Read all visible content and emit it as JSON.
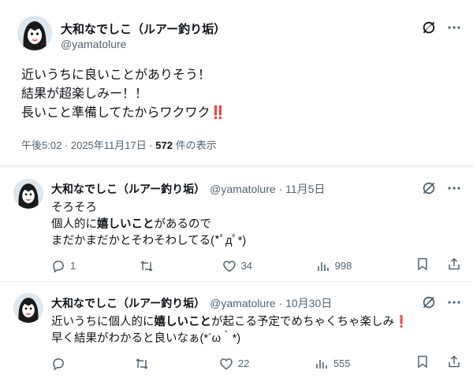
{
  "main": {
    "name": "大和なでしこ（ルアー釣り垢）",
    "handle": "@yamatolure",
    "lines": [
      "近いうちに良いことがありそう！",
      "結果が超楽しみー！！",
      "長いこと準備してたからワクワク"
    ],
    "emoji": "‼️",
    "time": "午後5:02 · 2025年11月17日 · ",
    "views": "572",
    "views_suffix": " 件の表示"
  },
  "replies": [
    {
      "name": "大和なでしこ（ルアー釣り垢）",
      "meta": "@yamatolure · 11月5日",
      "line1": "そろそろ",
      "line2_pre": "個人的に",
      "line2_bold": "嬉しいこと",
      "line2_post": "があるので",
      "line3": "まだかまだかとそわそわしてる(*ﾟдﾟ*)",
      "replies_count": "1",
      "reposts_count": "",
      "likes_count": "34",
      "views_count": "998"
    },
    {
      "name": "大和なでしこ（ルアー釣り垢）",
      "meta": "@yamatolure · 10月30日",
      "line1_pre": "近いうちに個人的に",
      "line1_bold": "嬉しいこと",
      "line1_post": "が起こる予定でめちゃくちゃ楽しみ",
      "line1_emoji": "❗",
      "line2": "早く結果がわかると良いなぁ(*´ω｀*)",
      "replies_count": "",
      "reposts_count": "",
      "likes_count": "22",
      "views_count": "555"
    }
  ],
  "icons": {
    "grok": "grok-icon",
    "more": "more-icon",
    "reply": "reply-icon",
    "repost": "repost-icon",
    "like": "like-icon",
    "views": "views-icon",
    "bookmark": "bookmark-icon",
    "share": "share-icon"
  },
  "colors": {
    "text": "#0f1419",
    "secondary": "#536471",
    "divider": "#eff3f4",
    "emoji_red": "#e0245e"
  }
}
